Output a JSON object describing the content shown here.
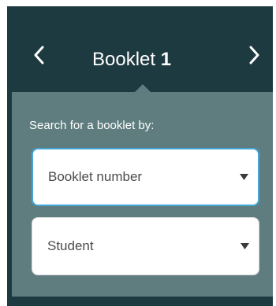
{
  "header": {
    "title_prefix": "Booklet",
    "title_number": "1",
    "prev_icon": "chevron-left-icon",
    "next_icon": "chevron-right-icon"
  },
  "search": {
    "label": "Search for a booklet by:",
    "selects": [
      {
        "value": "Booklet number",
        "focused": true
      },
      {
        "value": "Student",
        "focused": false
      }
    ]
  },
  "colors": {
    "header_bg": "#1d3a40",
    "popover_bg": "#5f7d7f",
    "focus_border": "#44a7d6"
  }
}
